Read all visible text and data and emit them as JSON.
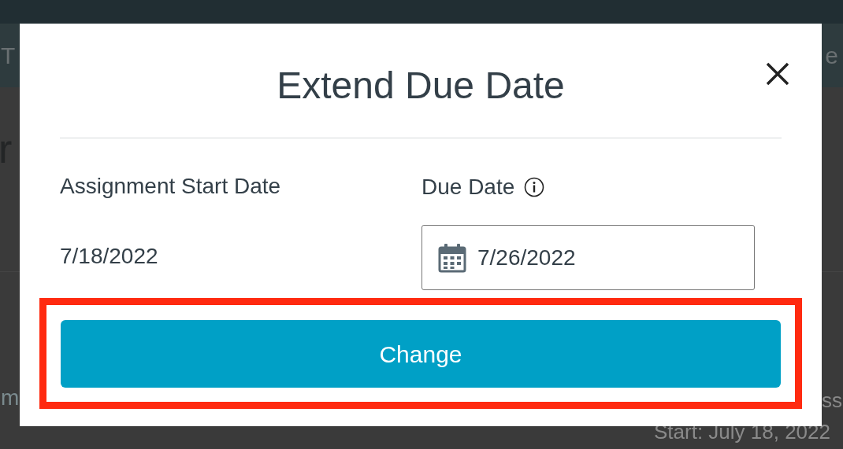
{
  "background": {
    "header_left": "T",
    "header_right": "e",
    "heading": "r",
    "row_left": "m",
    "row_right": "ss",
    "row_date": "Start: July 18, 2022"
  },
  "dialog": {
    "title": "Extend Due Date",
    "start_label": "Assignment Start Date",
    "start_value": "7/18/2022",
    "due_label": "Due Date",
    "due_value": "7/26/2022",
    "button": "Change",
    "highlighted": true
  }
}
